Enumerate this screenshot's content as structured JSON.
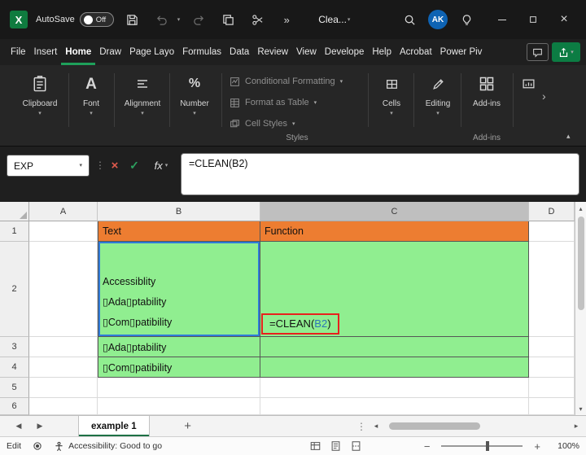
{
  "colors": {
    "accent_green": "#1ea05a",
    "share_green": "#0c7c43",
    "header_orange": "#ed7d31",
    "cell_green": "#90ee90",
    "ref_blue": "#2e75b6",
    "annotation_red": "#e8211d"
  },
  "icons": {
    "caret": "▾",
    "overflow": "»",
    "chevron_more": "›",
    "collapse": "▴",
    "close": "×",
    "check": "✓",
    "dots": "⋮",
    "nav_left": "◀",
    "nav_right": "▶",
    "scroll_left": "◂",
    "scroll_right": "▸",
    "scroll_up": "▴",
    "scroll_down": "▾",
    "plus": "+",
    "minus": "−",
    "logo_letter": "X"
  },
  "titlebar": {
    "autosave_label": "AutoSave",
    "autosave_state": "Off",
    "doc_title": "Clea...",
    "avatar_initials": "AK"
  },
  "ribbon_tabs": {
    "items": [
      "File",
      "Insert",
      "Home",
      "Draw",
      "Page Layo",
      "Formulas",
      "Data",
      "Review",
      "View",
      "Develope",
      "Help",
      "Acrobat",
      "Power Piv"
    ],
    "active": "Home"
  },
  "ribbon": {
    "clipboard": "Clipboard",
    "font": "Font",
    "alignment": "Alignment",
    "number": "Number",
    "styles_items": [
      "Conditional Formatting",
      "Format as Table",
      "Cell Styles"
    ],
    "styles_label": "Styles",
    "cells": "Cells",
    "editing": "Editing",
    "addins_button": "Add-ins",
    "addins_label": "Add-ins"
  },
  "formula_bar": {
    "name_box": "EXP",
    "fx": "fx",
    "formula": "=CLEAN(B2)"
  },
  "grid": {
    "columns": [
      "A",
      "B",
      "C",
      "D"
    ],
    "rows": [
      "1",
      "2",
      "3",
      "4",
      "5",
      "6"
    ],
    "b1": "Text",
    "c1": "Function",
    "b2_lines": [
      "Accessiblity",
      "▯Ada▯ptability",
      "▯Com▯patibility"
    ],
    "c2_prefix": "=CLEAN(",
    "c2_ref": "B2",
    "c2_suffix": ")",
    "b3": "▯Ada▯ptability",
    "b4": "▯Com▯patibility"
  },
  "sheet_bar": {
    "tab": "example 1"
  },
  "status_bar": {
    "mode": "Edit",
    "accessibility": "Accessibility: Good to go",
    "zoom": "100%"
  }
}
